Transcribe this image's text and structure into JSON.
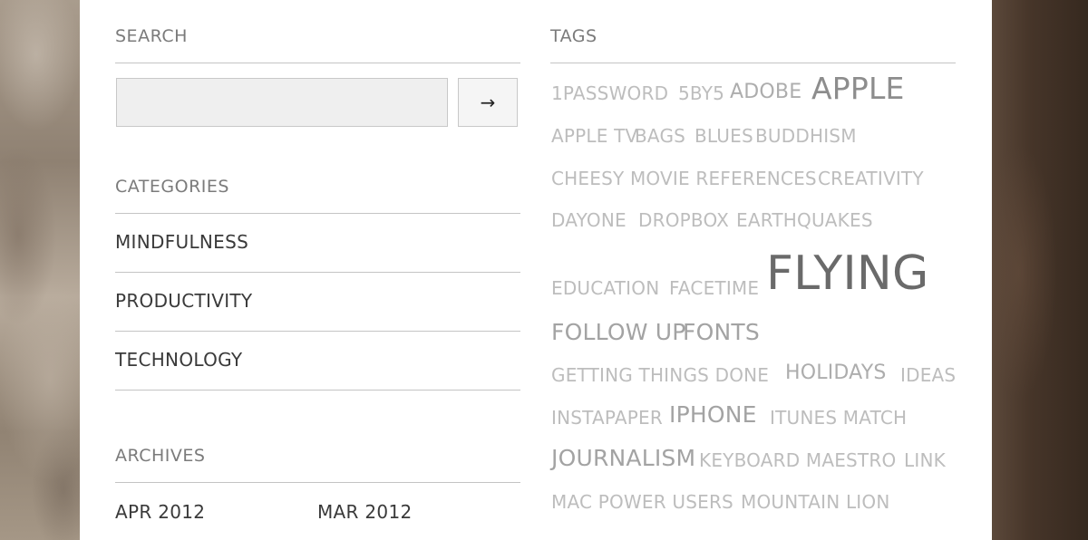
{
  "search": {
    "heading": "SEARCH",
    "input_value": "",
    "input_placeholder": "",
    "button_icon": "arrow-right-icon",
    "button_glyph": "→"
  },
  "categories": {
    "heading": "CATEGORIES",
    "items": [
      "MINDFULNESS",
      "PRODUCTIVITY",
      "TECHNOLOGY"
    ]
  },
  "archives": {
    "heading": "ARCHIVES",
    "items": [
      "APR 2012",
      "MAR 2012"
    ]
  },
  "tags": {
    "heading": "TAGS",
    "items": [
      "1PASSWORD",
      "5BY5",
      "ADOBE",
      "APPLE",
      "APPLE TV",
      "BAGS",
      "BLUES",
      "BUDDHISM",
      "CHEESY MOVIE REFERENCES",
      "CREATIVITY",
      "DAYONE",
      "DROPBOX",
      "EARTHQUAKES",
      "EDUCATION",
      "FACETIME",
      "FLYING",
      "FOLLOW UP",
      "FONTS",
      "GETTING THINGS DONE",
      "HOLIDAYS",
      "IDEAS",
      "INSTAPAPER",
      "IPHONE",
      "ITUNES MATCH",
      "JOURNALISM",
      "KEYBOARD MAESTRO",
      "LINK",
      "MAC POWER USERS",
      "MOUNTAIN LION"
    ]
  },
  "colors": {
    "heading_gray": "#7b7b7b",
    "link_dark": "#3a3a3a",
    "tag_light": "#bdbdbd",
    "rule": "#c4c4c4",
    "input_bg": "#efefef"
  }
}
